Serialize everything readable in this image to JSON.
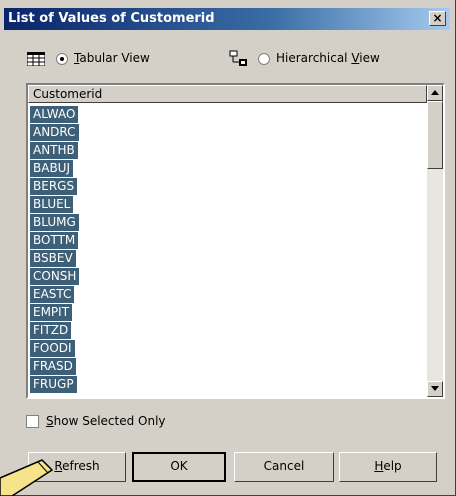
{
  "window": {
    "title": "List of Values of Customerid",
    "close_glyph": "×"
  },
  "view_options": {
    "tabular": {
      "underline_char": "T",
      "rest": "abular View",
      "selected": true
    },
    "hierarchical": {
      "prefix": "Hierarchical ",
      "underline_char": "V",
      "rest": "iew",
      "selected": false
    }
  },
  "list": {
    "column_header": "Customerid",
    "items": [
      "ALWAO",
      "ANDRC",
      "ANTHB",
      "BABUJ",
      "BERGS",
      "BLUEL",
      "BLUMG",
      "BOTTM",
      "BSBEV",
      "CONSH",
      "EASTC",
      "EMPIT",
      "FITZD",
      "FOODI",
      "FRASD",
      "FRUGP"
    ],
    "selection_color": "#3d5f77"
  },
  "show_selected": {
    "underline_char": "S",
    "rest": "how Selected Only",
    "checked": false
  },
  "buttons": {
    "refresh": {
      "underline_char": "R",
      "rest": "efresh"
    },
    "ok": "OK",
    "cancel": "Cancel",
    "help": {
      "underline_char": "H",
      "rest": "elp"
    }
  }
}
